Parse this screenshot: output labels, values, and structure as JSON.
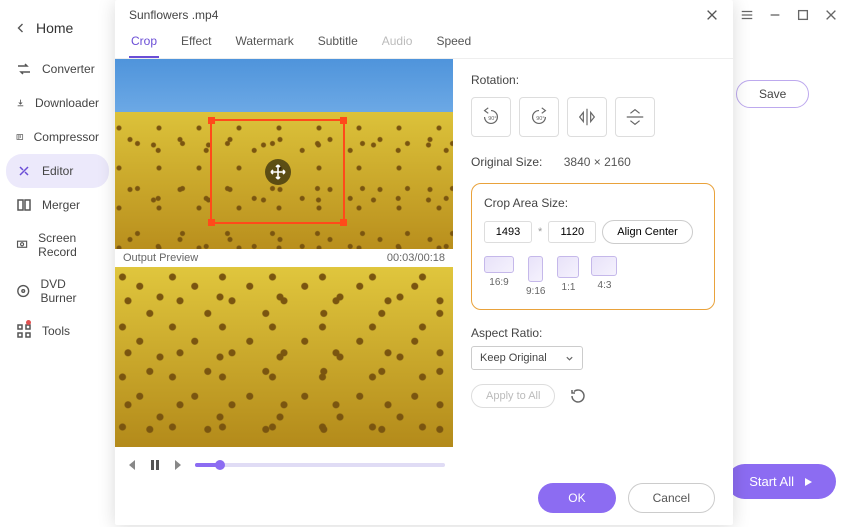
{
  "sidebar": {
    "back_label": "Home",
    "items": [
      {
        "label": "Converter"
      },
      {
        "label": "Downloader"
      },
      {
        "label": "Compressor"
      },
      {
        "label": "Editor"
      },
      {
        "label": "Merger"
      },
      {
        "label": "Screen Record"
      },
      {
        "label": "DVD Burner"
      },
      {
        "label": "Tools"
      }
    ]
  },
  "background": {
    "save_label": "Save",
    "start_all_label": "Start All"
  },
  "dialog": {
    "title": "Sunflowers .mp4",
    "tabs": [
      "Crop",
      "Effect",
      "Watermark",
      "Subtitle",
      "Audio",
      "Speed"
    ],
    "active_tab": "Crop",
    "disabled_tab": "Audio",
    "preview": {
      "output_label": "Output Preview",
      "time": "00:03/00:18"
    },
    "controls": {
      "rotation_label": "Rotation:",
      "rotation_options": [
        "rotate-ccw-90",
        "rotate-cw-90",
        "flip-horizontal",
        "flip-vertical"
      ],
      "original_size_label": "Original Size:",
      "original_size_value": "3840 × 2160",
      "crop_area_label": "Crop Area Size:",
      "crop_w": "1493",
      "crop_h": "1120",
      "align_center_label": "Align Center",
      "aspect_presets": [
        "16:9",
        "9:16",
        "1:1",
        "4:3"
      ],
      "aspect_ratio_label": "Aspect Ratio:",
      "aspect_ratio_value": "Keep Original",
      "apply_all_label": "Apply to All"
    },
    "footer": {
      "ok": "OK",
      "cancel": "Cancel"
    }
  }
}
